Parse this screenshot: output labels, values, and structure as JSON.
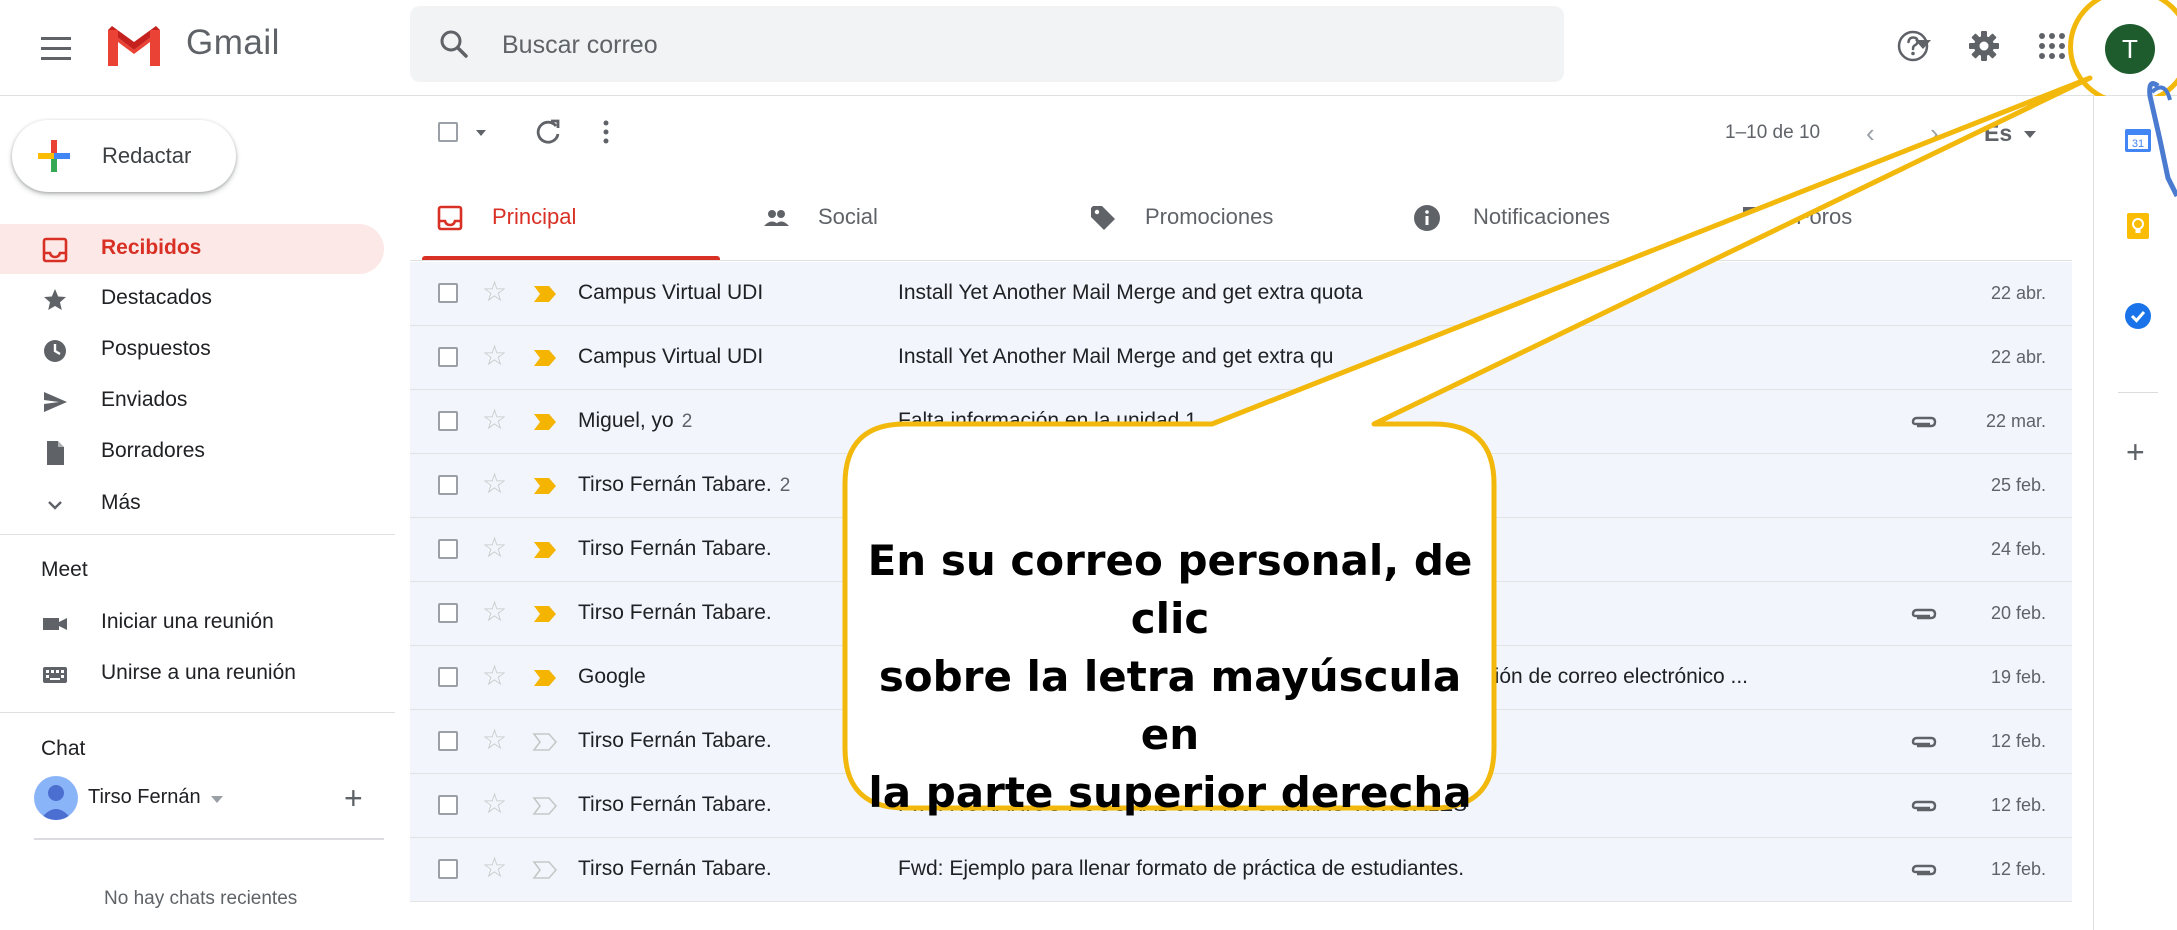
{
  "app": {
    "name": "Gmail"
  },
  "search": {
    "placeholder": "Buscar correo"
  },
  "user": {
    "avatar_letter": "T",
    "avatar_color": "#1e5c2e"
  },
  "compose": {
    "label": "Redactar"
  },
  "nav": {
    "items": [
      {
        "label": "Recibidos",
        "icon": "inbox-icon",
        "active": true
      },
      {
        "label": "Destacados",
        "icon": "star-icon"
      },
      {
        "label": "Pospuestos",
        "icon": "clock-icon"
      },
      {
        "label": "Enviados",
        "icon": "send-icon"
      },
      {
        "label": "Borradores",
        "icon": "draft-icon"
      },
      {
        "label": "Más",
        "icon": "chevron-down-icon"
      }
    ]
  },
  "meet": {
    "title": "Meet",
    "items": [
      {
        "label": "Iniciar una reunión",
        "icon": "video-icon"
      },
      {
        "label": "Unirse a una reunión",
        "icon": "keyboard-icon"
      }
    ]
  },
  "chat": {
    "title": "Chat",
    "user_name": "Tirso Fernán",
    "empty_text": "No hay chats recientes"
  },
  "toolbar": {
    "pagination": "1–10 de 10",
    "language": "Es"
  },
  "tabs": [
    {
      "label": "Principal",
      "icon": "inbox-tab-icon",
      "active": true
    },
    {
      "label": "Social",
      "icon": "people-icon"
    },
    {
      "label": "Promociones",
      "icon": "tag-icon"
    },
    {
      "label": "Notificaciones",
      "icon": "info-icon"
    },
    {
      "label": "Foros",
      "icon": "forum-icon"
    }
  ],
  "emails": [
    {
      "sender": "Campus Virtual UDI",
      "count": "",
      "subject": "Install Yet Another Mail Merge and get extra quota",
      "date": "22 abr.",
      "important": true,
      "attachment": false
    },
    {
      "sender": "Campus Virtual UDI",
      "count": "",
      "subject": "Install Yet Another Mail Merge and get extra qu",
      "date": "22 abr.",
      "important": true,
      "attachment": false
    },
    {
      "sender": "Miguel, yo",
      "count": "2",
      "subject": "Falta información en la unidad 1",
      "date": "22 mar.",
      "important": true,
      "attachment": true
    },
    {
      "sender": "Tirso Fernán Tabare.",
      "count": "2",
      "subject": "",
      "date": "25 feb.",
      "important": true,
      "attachment": false
    },
    {
      "sender": "Tirso Fernán Tabare.",
      "count": "",
      "subject": "",
      "date": "24 feb.",
      "important": true,
      "attachment": false
    },
    {
      "sender": "Tirso Fernán Tabare.",
      "count": "",
      "subject": "",
      "date": "20 feb.",
      "important": true,
      "attachment": true
    },
    {
      "sender": "Google",
      "count": "",
      "subject": "o su dirección de correo electrónico ...",
      "date": "19 feb.",
      "important": true,
      "attachment": false
    },
    {
      "sender": "Tirso Fernán Tabare.",
      "count": "",
      "subject": "",
      "date": "12 feb.",
      "important": false,
      "attachment": true
    },
    {
      "sender": "Tirso Fernán Tabare.",
      "count": "",
      "subject": "Fwd: HORARIOS POSGRADOS  PROGRAMAS VIRTUALES",
      "date": "12 feb.",
      "important": false,
      "attachment": true
    },
    {
      "sender": "Tirso Fernán Tabare.",
      "count": "",
      "subject": "Fwd: Ejemplo para llenar formato de práctica de estudiantes.",
      "date": "12 feb.",
      "important": false,
      "attachment": true
    }
  ],
  "callout": {
    "lines": [
      "En su correo personal, de clic",
      "sobre la letra mayúscula en",
      "la parte superior derecha"
    ],
    "color": "#f2b90c"
  },
  "side_panel": {
    "calendar_day": "31"
  }
}
